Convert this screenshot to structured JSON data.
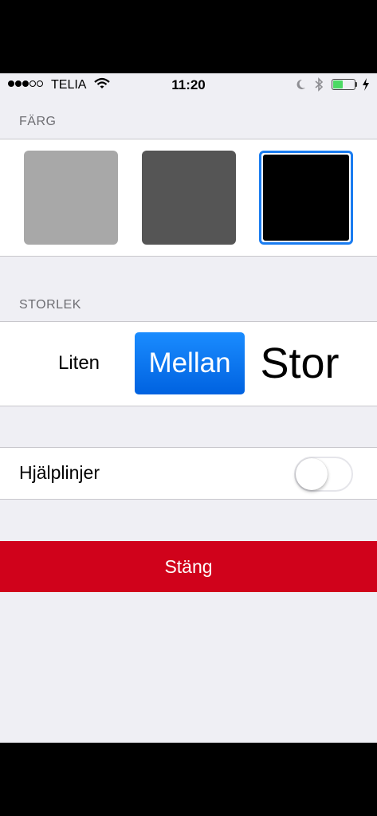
{
  "status_bar": {
    "carrier": "TELIA",
    "time": "11:20",
    "battery_level": 0.45
  },
  "color_section": {
    "header": "FÄRG",
    "swatches": [
      {
        "color": "#a8a8a8",
        "selected": false
      },
      {
        "color": "#555555",
        "selected": false
      },
      {
        "color": "#000000",
        "selected": true
      }
    ],
    "selected_outline": "#1a7cf0"
  },
  "size_section": {
    "header": "STORLEK",
    "options": [
      "Liten",
      "Mellan",
      "Stor"
    ],
    "selected": "Mellan"
  },
  "guides": {
    "label": "Hjälplinjer",
    "enabled": false
  },
  "close_button": {
    "label": "Stäng",
    "color": "#d0021b"
  }
}
